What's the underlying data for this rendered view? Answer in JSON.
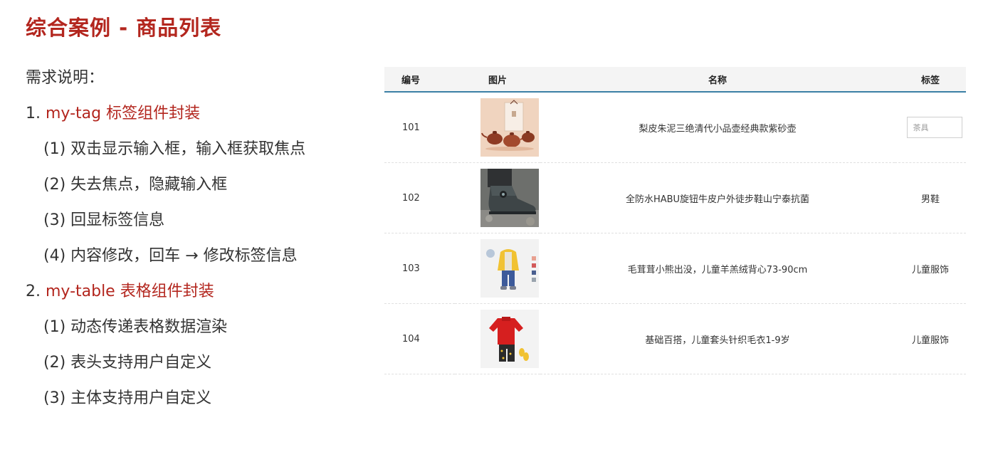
{
  "title": "综合案例 - 商品列表",
  "requirements": {
    "heading": "需求说明：",
    "item1_num": "1.",
    "item1_label": "my-tag 标签组件封装",
    "item1_subs": [
      "(1) 双击显示输入框，输入框获取焦点",
      "(2) 失去焦点，隐藏输入框",
      "(3) 回显标签信息",
      "(4) 内容修改，回车 → 修改标签信息"
    ],
    "item2_num": "2.",
    "item2_label": "my-table 表格组件封装",
    "item2_subs": [
      "(1) 动态传递表格数据渲染",
      "(2) 表头支持用户自定义",
      "(3) 主体支持用户自定义"
    ]
  },
  "table": {
    "headers": {
      "id": "编号",
      "image": "图片",
      "name": "名称",
      "tag": "标签"
    },
    "rows": [
      {
        "id": "101",
        "image": "teapot-product-image",
        "name": "梨皮朱泥三绝清代小品壶经典款紫砂壶",
        "tag": "茶具",
        "tag_editing": true
      },
      {
        "id": "102",
        "image": "hiking-shoe-product-image",
        "name": "全防水HABU旋钮牛皮户外徒步鞋山宁泰抗菌",
        "tag": "男鞋"
      },
      {
        "id": "103",
        "image": "kids-vest-outfit-product-image",
        "name": "毛茸茸小熊出没，儿童羊羔绒背心73-90cm",
        "tag": "儿童服饰"
      },
      {
        "id": "104",
        "image": "kids-sweater-outfit-product-image",
        "name": "基础百搭，儿童套头针织毛衣1-9岁",
        "tag": "儿童服饰"
      }
    ]
  },
  "colors": {
    "accent": "#b3261e",
    "header_border": "#3c7fa5"
  }
}
